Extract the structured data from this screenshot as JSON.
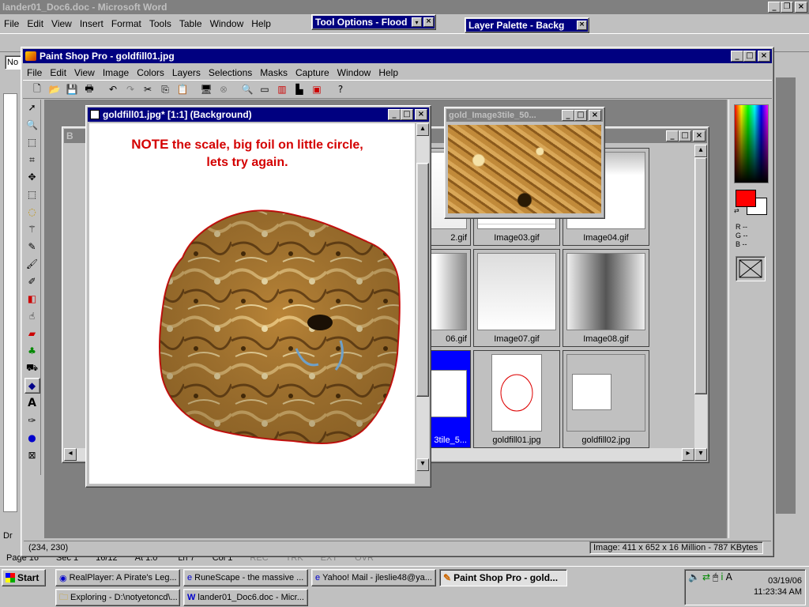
{
  "word": {
    "title": "lander01_Doc6.doc - Microsoft Word",
    "menus": [
      "File",
      "Edit",
      "View",
      "Insert",
      "Format",
      "Tools",
      "Table",
      "Window",
      "Help"
    ],
    "style_box": "No",
    "status": {
      "page": "Page 16",
      "sec": "Sec 1",
      "pages": "16/12",
      "at": "At 1.0\"",
      "ln": "Ln 7",
      "col": "Col 1",
      "rec": "REC",
      "trk": "TRK",
      "ext": "EXT",
      "ovr": "OVR"
    },
    "draw_label": "Dr"
  },
  "floating": {
    "tool_options": "Tool Options - Flood",
    "layer_palette": "Layer Palette - Backg"
  },
  "psp": {
    "title": "Paint Shop Pro - goldfill01.jpg",
    "menus": [
      "File",
      "Edit",
      "View",
      "Image",
      "Colors",
      "Layers",
      "Selections",
      "Masks",
      "Capture",
      "Window",
      "Help"
    ],
    "status_coords": "(234, 230)",
    "status_image": "Image:  411 x 652 x 16 Million - 787 KBytes",
    "rgb": {
      "r": "R --",
      "g": "G --",
      "b": "B --"
    },
    "colors": {
      "foreground": "#ff0000",
      "background": "#ffffff"
    }
  },
  "doc_window": {
    "title": "goldfill01.jpg* [1:1] (Background)",
    "note_line1_strong": "NOTE",
    "note_line1_rest": " the scale, big foil on little circle,",
    "note_line2": "lets try again."
  },
  "tile_window": {
    "title": "gold_Image3tile_50..."
  },
  "browse_window": {
    "title_abbrev": "B",
    "thumbs": [
      {
        "label": "2.gif"
      },
      {
        "label": "Image03.gif"
      },
      {
        "label": "Image04.gif"
      },
      {
        "label": "06.gif"
      },
      {
        "label": "Image07.gif"
      },
      {
        "label": "Image08.gif"
      },
      {
        "label": "3tile_5..."
      },
      {
        "label": "goldfill01.jpg"
      },
      {
        "label": "goldfill02.jpg"
      }
    ]
  },
  "taskbar": {
    "start": "Start",
    "row1": [
      "RealPlayer: A Pirate's Leg...",
      "RuneScape - the massive ...",
      "Yahoo! Mail - jleslie48@ya...",
      "Paint Shop Pro - gold..."
    ],
    "row2": [
      "Exploring - D:\\notyetoncd\\...",
      "lander01_Doc6.doc - Micr..."
    ],
    "date": "03/19/06",
    "time": "11:23:34 AM"
  }
}
